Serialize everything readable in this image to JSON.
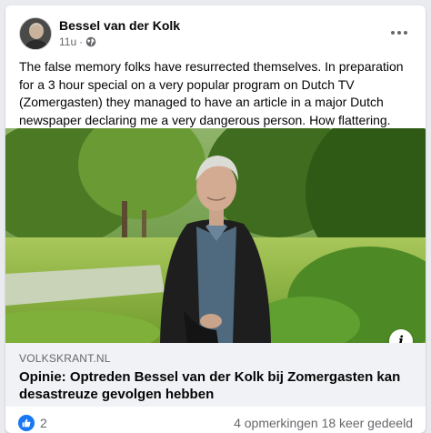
{
  "post": {
    "author": "Bessel van der Kolk",
    "time": "11u",
    "separator": "·",
    "body": "The false memory folks have resurrected themselves. In preparation for a 3 hour special on a very popular program on Dutch TV (Zomergasten) they managed to have an article in a major Dutch newspaper declaring me a very dangerous person. How flattering. Deja vue all over again."
  },
  "link": {
    "source": "VOLKSKRANT.NL",
    "title": "Opinie: Optreden Bessel van der Kolk bij Zomergasten kan desastreuze gevolgen hebben"
  },
  "footer": {
    "reaction_count": "2",
    "stats": "4 opmerkingen  18 keer gedeeld"
  },
  "icons": {
    "more": "more-options-icon",
    "audience": "globe-icon",
    "info": "info-icon",
    "like": "like-icon"
  },
  "colors": {
    "accent": "#1877f2",
    "secondary_text": "#65676b",
    "link_box": "#f0f2f5"
  }
}
